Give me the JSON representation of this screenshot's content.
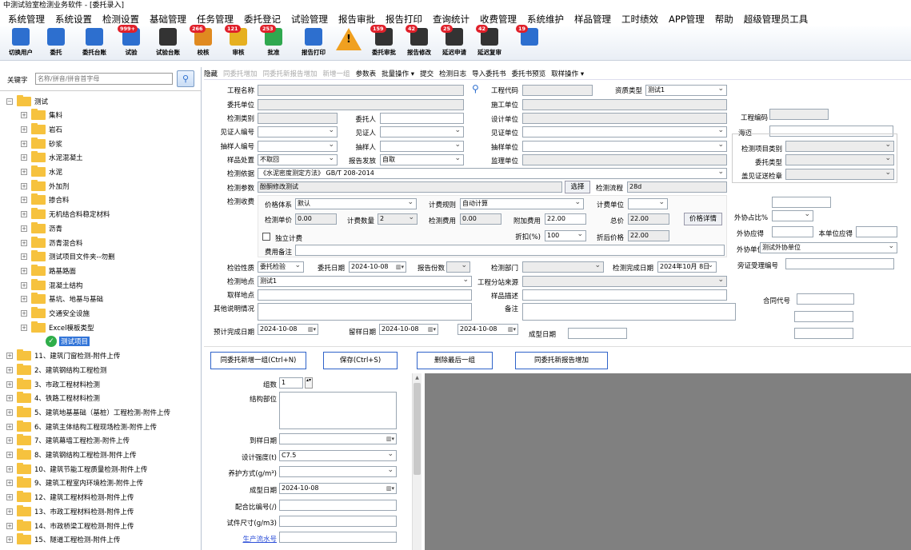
{
  "window": {
    "title": "中测试验室检测业务软件 - [委托录入]"
  },
  "menu": [
    "系统管理",
    "系统设置",
    "检测设置",
    "基础管理",
    "任务管理",
    "委托登记",
    "试验管理",
    "报告审批",
    "报告打印",
    "查询统计",
    "收费管理",
    "系统维护",
    "样品管理",
    "工时绩效",
    "APP管理",
    "帮助",
    "超级管理员工具"
  ],
  "toolbar": [
    {
      "label": "切换用户",
      "badge": "",
      "icon": "users-icon",
      "color": "#2d6fcf"
    },
    {
      "label": "委托",
      "badge": "",
      "icon": "document-icon",
      "color": "#2d6fcf"
    },
    {
      "label": "委托台账",
      "badge": "",
      "icon": "ledger-icon",
      "color": "#2d6fcf"
    },
    {
      "label": "试验",
      "badge": "999+",
      "icon": "monitor-icon",
      "color": "#2d6fcf"
    },
    {
      "label": "试验台账",
      "badge": "",
      "icon": "report-icon",
      "color": "#333333"
    },
    {
      "label": "校核",
      "badge": "266",
      "icon": "magnify-icon",
      "color": "#e08a20"
    },
    {
      "label": "审核",
      "badge": "121",
      "icon": "check-pen-icon",
      "color": "#e6b020"
    },
    {
      "label": "批准",
      "badge": "253",
      "icon": "approve-icon",
      "color": "#2fa84f"
    },
    {
      "label": "报告打印",
      "badge": "",
      "icon": "printer-icon",
      "color": "#2d6fcf"
    },
    {
      "label": "",
      "badge": "",
      "icon": "warning-icon",
      "color": "#f0a020"
    },
    {
      "label": "委托审批",
      "badge": "159",
      "icon": "person-icon",
      "color": "#333333"
    },
    {
      "label": "报告修改",
      "badge": "42",
      "icon": "person-edit-icon",
      "color": "#333333"
    },
    {
      "label": "延迟申请",
      "badge": "25",
      "icon": "person-clock-icon",
      "color": "#333333"
    },
    {
      "label": "延迟复审",
      "badge": "42",
      "icon": "person-review-icon",
      "color": "#333333"
    },
    {
      "label": "",
      "badge": "19",
      "icon": "list-icon",
      "color": "#2d6fcf"
    }
  ],
  "left": {
    "search_label": "关键字",
    "search_placeholder": "名称/拼音/拼音首字母",
    "tree": [
      {
        "label": "测试",
        "level": 0,
        "pm": "−",
        "type": "folder"
      },
      {
        "label": "集料",
        "level": 1,
        "pm": "+",
        "type": "folder"
      },
      {
        "label": "岩石",
        "level": 1,
        "pm": "+",
        "type": "folder"
      },
      {
        "label": "砂浆",
        "level": 1,
        "pm": "+",
        "type": "folder"
      },
      {
        "label": "水泥混凝土",
        "level": 1,
        "pm": "+",
        "type": "folder"
      },
      {
        "label": "水泥",
        "level": 1,
        "pm": "+",
        "type": "folder"
      },
      {
        "label": "外加剂",
        "level": 1,
        "pm": "+",
        "type": "folder"
      },
      {
        "label": "掺合料",
        "level": 1,
        "pm": "+",
        "type": "folder"
      },
      {
        "label": "无机结合料稳定材料",
        "level": 1,
        "pm": "+",
        "type": "folder"
      },
      {
        "label": "沥青",
        "level": 1,
        "pm": "+",
        "type": "folder"
      },
      {
        "label": "沥青混合料",
        "level": 1,
        "pm": "+",
        "type": "folder"
      },
      {
        "label": "测试项目文件夹--勿删",
        "level": 1,
        "pm": "+",
        "type": "folder"
      },
      {
        "label": "路基路面",
        "level": 1,
        "pm": "+",
        "type": "folder"
      },
      {
        "label": "混凝土结构",
        "level": 1,
        "pm": "+",
        "type": "folder"
      },
      {
        "label": "基坑、地基与基础",
        "level": 1,
        "pm": "+",
        "type": "folder"
      },
      {
        "label": "交通安全设施",
        "level": 1,
        "pm": "+",
        "type": "folder"
      },
      {
        "label": "Excel模板类型",
        "level": 1,
        "pm": "+",
        "type": "folder"
      },
      {
        "label": "测试项目",
        "level": 2,
        "pm": "",
        "type": "check"
      },
      {
        "label": "11、建筑门窗检测-附件上传",
        "level": 0,
        "pm": "+",
        "type": "folder"
      },
      {
        "label": "2、建筑钢结构工程检测",
        "level": 0,
        "pm": "+",
        "type": "folder"
      },
      {
        "label": "3、市政工程材料检测",
        "level": 0,
        "pm": "+",
        "type": "folder"
      },
      {
        "label": "4、铁路工程材料检测",
        "level": 0,
        "pm": "+",
        "type": "folder"
      },
      {
        "label": "5、建筑地基基础（基桩）工程检测-附件上传",
        "level": 0,
        "pm": "+",
        "type": "folder"
      },
      {
        "label": "6、建筑主体结构工程现场检测-附件上传",
        "level": 0,
        "pm": "+",
        "type": "folder"
      },
      {
        "label": "7、建筑幕墙工程检测-附件上传",
        "level": 0,
        "pm": "+",
        "type": "folder"
      },
      {
        "label": "8、建筑钢结构工程检测-附件上传",
        "level": 0,
        "pm": "+",
        "type": "folder"
      },
      {
        "label": "10、建筑节能工程质量检测-附件上传",
        "level": 0,
        "pm": "+",
        "type": "folder"
      },
      {
        "label": "9、建筑工程室内环境检测-附件上传",
        "level": 0,
        "pm": "+",
        "type": "folder"
      },
      {
        "label": "12、建筑工程材料检测-附件上传",
        "level": 0,
        "pm": "+",
        "type": "folder"
      },
      {
        "label": "13、市政工程材料检测-附件上传",
        "level": 0,
        "pm": "+",
        "type": "folder"
      },
      {
        "label": "14、市政桥梁工程检测-附件上传",
        "level": 0,
        "pm": "+",
        "type": "folder"
      },
      {
        "label": "15、隧道工程检测-附件上传",
        "level": 0,
        "pm": "+",
        "type": "folder"
      }
    ]
  },
  "actions": [
    {
      "label": "隐藏",
      "disabled": false
    },
    {
      "label": "同委托增加",
      "disabled": true
    },
    {
      "label": "同委托新报告增加",
      "disabled": true
    },
    {
      "label": "新增一组",
      "disabled": true
    },
    {
      "label": "参数表",
      "disabled": false
    },
    {
      "label": "批量操作 ▾",
      "disabled": false
    },
    {
      "label": "提交",
      "disabled": false
    },
    {
      "label": "检测日志",
      "disabled": false
    },
    {
      "label": "导入委托书",
      "disabled": false
    },
    {
      "label": "委托书预览",
      "disabled": false
    },
    {
      "label": "取样操作 ▾",
      "disabled": false
    }
  ],
  "form": {
    "labels": {
      "project_name": "工程名称",
      "project_code": "工程代码",
      "capital_type": "资质类型",
      "client_unit": "委托单位",
      "construction_unit": "施工单位",
      "test_category": "检测类别",
      "client_person": "委托人",
      "design_unit": "设计单位",
      "project_number": "工程编码",
      "witness_number": "见证人编号",
      "witness": "见证人",
      "witness_unit": "见证单位",
      "sampler_number": "抽样人编号",
      "sampler": "抽样人",
      "sampling_unit": "抽样单位",
      "sample_disposal": "样品处置",
      "report_issue": "报告发放",
      "supervision_unit": "监理单位",
      "test_basis": "检测依据",
      "test_params": "检测参数",
      "test_flow": "检测流程",
      "test_fee": "检测收费",
      "price_system": "价格体系",
      "fee_rule": "计费规则",
      "fee_unit": "计费单位",
      "unit_price": "检测单价",
      "fee_qty": "计费数量",
      "test_cost": "检测费用",
      "extra_fee": "附加费用",
      "total": "总价",
      "independent": "独立计费",
      "discount": "折扣(%)",
      "after_discount": "折后价格",
      "fee_note": "费用备注",
      "test_nature": "检验性质",
      "client_date": "委托日期",
      "report_copies": "报告份数",
      "test_dept": "检测部门",
      "finish_date": "检测完成日期",
      "test_location": "检测地点",
      "subcontract_src": "工程分站来源",
      "sampling_site": "取样地点",
      "sample_desc": "样品描述",
      "other_info": "其他说明情况",
      "remark": "备注",
      "expected_date": "预计完成日期",
      "retention_date": "留样日期",
      "forming_date": "成型日期",
      "sea_side": "海迈",
      "item_type": "检测项目类别",
      "client_type": "委托类型",
      "witness_seal": "盖见证送检章",
      "outsource_ratio": "外协占比%",
      "outsource_due": "外协应得",
      "unit_due": "本单位应得",
      "outsource_unit": "外协单位",
      "cert_number": "旁证受理编号",
      "contract_code": "合同代号"
    },
    "values": {
      "capital_type": "测试1",
      "test_basis": "《水泥密度测定方法》 GB/T 208-2014",
      "test_params": "酚酮修改测试",
      "test_flow": "28d",
      "price_system": "默认",
      "fee_rule": "自动计算",
      "unit_price": "0.00",
      "fee_qty": "2",
      "test_cost": "0.00",
      "extra_fee": "22.00",
      "total": "22.00",
      "discount": "100",
      "after_discount": "22.00",
      "sample_disposal": "不取回",
      "report_issue": "自取",
      "test_nature": "委托检验",
      "client_date": "2024-10-08",
      "finish_date": "2024年10月 8日",
      "test_location": "测试1",
      "expected_date": "2024-10-08",
      "retention_date": "2024-10-08",
      "third_date": "2024-10-08",
      "outsource_unit": "测试外协单位"
    },
    "buttons": {
      "select": "选择",
      "price_detail": "价格详情"
    }
  },
  "bottom": {
    "buttons": [
      "同委托新增一组(Ctrl+N)",
      "保存(Ctrl+S)",
      "删除最后一组",
      "同委托新报告增加"
    ],
    "labels": {
      "group_count": "组数",
      "struct_part": "结构部位",
      "due_date": "到样日期",
      "design_strength": "设计强度(t)",
      "curing": "养护方式(g/m³)",
      "forming_date": "成型日期",
      "mix_number": "配合比编号(/)",
      "specimen_size": "试件尺寸(g/m3)",
      "production_no": "生产流水号"
    },
    "values": {
      "group_count": "1",
      "design_strength": "C7.5",
      "forming_date": "2024-10-08"
    }
  }
}
